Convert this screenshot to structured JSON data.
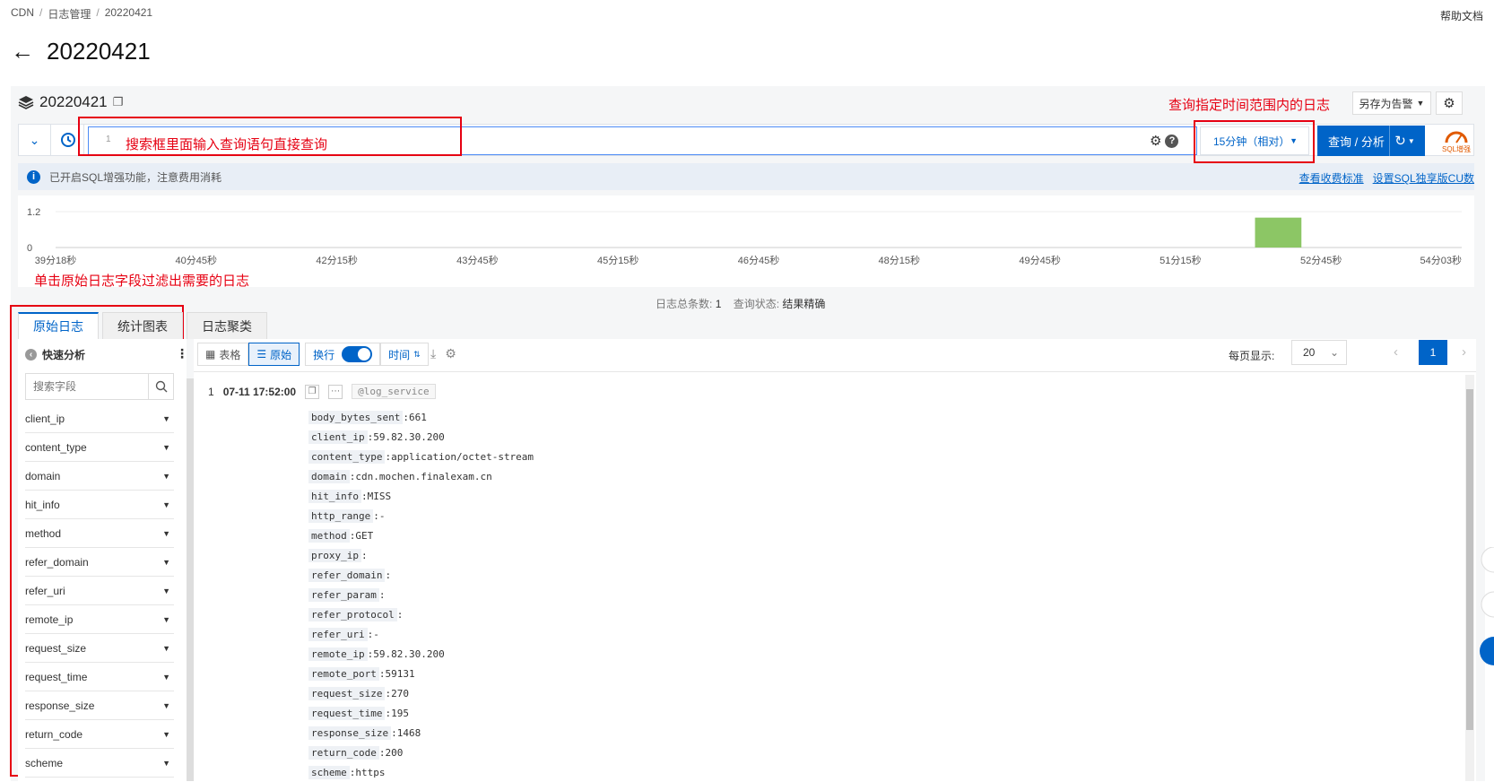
{
  "breadcrumb": [
    "CDN",
    "日志管理",
    "20220421"
  ],
  "help_link": "帮助文档",
  "page_title": "20220421",
  "logstore": {
    "name": "20220421"
  },
  "annotations": {
    "time_range_note": "查询指定时间范围内的日志",
    "search_note": "搜索框里面输入查询语句直接查询",
    "field_note": "单击原始日志字段过滤出需要的日志"
  },
  "toolbar_top": {
    "save_alert": "另存为告警"
  },
  "search": {
    "line_number": "1",
    "time_range": "15分钟（相对）",
    "query_button": "查询 / 分析",
    "sql_badge": "SQL增强"
  },
  "info_bar": {
    "message": "已开启SQL增强功能，注意费用消耗",
    "link_pricing": "查看收费标准",
    "link_cu": "设置SQL独享版CU数"
  },
  "chart_data": {
    "type": "bar",
    "categories": [
      "39分18秒",
      "40分45秒",
      "42分15秒",
      "43分45秒",
      "45分15秒",
      "46分45秒",
      "48分15秒",
      "49分45秒",
      "51分15秒",
      "52分45秒",
      "54分03秒"
    ],
    "yticks": [
      "1.2",
      "0"
    ],
    "ylim": [
      0,
      1.2
    ],
    "bar": {
      "x_start": "52分00秒",
      "x_end": "52分30秒",
      "value": 1
    },
    "bar_color": "#8cc665"
  },
  "summary": {
    "total_label": "日志总条数:",
    "total_value": "1",
    "status_label": "查询状态:",
    "status_value": "结果精确"
  },
  "tabs": [
    "原始日志",
    "统计图表",
    "日志聚类"
  ],
  "quick_analysis": {
    "title": "快速分析",
    "search_placeholder": "搜索字段"
  },
  "fields": [
    "client_ip",
    "content_type",
    "domain",
    "hit_info",
    "method",
    "refer_domain",
    "refer_uri",
    "remote_ip",
    "request_size",
    "request_time",
    "response_size",
    "return_code",
    "scheme"
  ],
  "view_toolbar": {
    "table": "表格",
    "raw": "原始",
    "wrap": "换行",
    "time": "时间"
  },
  "pagination": {
    "per_page_label": "每页显示:",
    "per_page_value": "20",
    "current_page": "1"
  },
  "log_entry": {
    "index": "1",
    "time": "07-11 17:52:00",
    "source_tag": "@log_service",
    "fields": [
      {
        "k": "body_bytes_sent",
        "v": "661"
      },
      {
        "k": "client_ip",
        "v": "59.82.30.200"
      },
      {
        "k": "content_type",
        "v": "application/octet-stream"
      },
      {
        "k": "domain",
        "v": "cdn.mochen.finalexam.cn"
      },
      {
        "k": "hit_info",
        "v": "MISS"
      },
      {
        "k": "http_range",
        "v": "-"
      },
      {
        "k": "method",
        "v": "GET"
      },
      {
        "k": "proxy_ip",
        "v": ""
      },
      {
        "k": "refer_domain",
        "v": ""
      },
      {
        "k": "refer_param",
        "v": ""
      },
      {
        "k": "refer_protocol",
        "v": ""
      },
      {
        "k": "refer_uri",
        "v": "-"
      },
      {
        "k": "remote_ip",
        "v": "59.82.30.200"
      },
      {
        "k": "remote_port",
        "v": "59131"
      },
      {
        "k": "request_size",
        "v": "270"
      },
      {
        "k": "request_time",
        "v": "195"
      },
      {
        "k": "response_size",
        "v": "1468"
      },
      {
        "k": "return_code",
        "v": "200"
      },
      {
        "k": "scheme",
        "v": "https"
      }
    ]
  }
}
